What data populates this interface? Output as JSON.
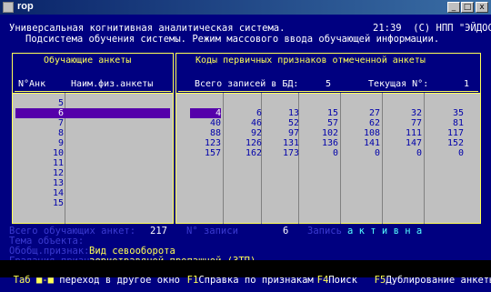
{
  "window": {
    "title": "rop",
    "icon_glyph": "",
    "minimize_glyph": "_",
    "maximize_glyph": "□",
    "close_glyph": "x"
  },
  "header": {
    "line1": "Универсальная когнитивная аналитическая система.",
    "time_and_copyright": "21:39  (C) НПП \"ЭЙДОС\"",
    "line2": "Подсистема обучения системы. Режим массового ввода обучающей информации."
  },
  "left_panel": {
    "title": "Обучающие анкеты",
    "col_num": "N°Анк",
    "col_name": "Наим.физ.анкеты",
    "rows": [
      "5",
      "6",
      "7",
      "8",
      "9",
      "10",
      "11",
      "12",
      "13",
      "14",
      "15"
    ],
    "selected_row": "6"
  },
  "right_panel": {
    "title": "Коды первичных признаков отмеченной анкеты",
    "total_label": "Всего записей в БД:",
    "total_value": "5",
    "current_label": "Текущая N°:",
    "current_value": "1",
    "grid": [
      [
        "4",
        "6",
        "13",
        "15",
        "27",
        "32",
        "35"
      ],
      [
        "40",
        "46",
        "52",
        "57",
        "62",
        "77",
        "81"
      ],
      [
        "88",
        "92",
        "97",
        "102",
        "108",
        "111",
        "117"
      ],
      [
        "123",
        "126",
        "131",
        "136",
        "141",
        "147",
        "152"
      ],
      [
        "157",
        "162",
        "173",
        "0",
        "0",
        "0",
        "0"
      ]
    ]
  },
  "info": {
    "all_label": "Всего обучающих анкет:",
    "all_value": "217",
    "rec_label": "N° записи",
    "rec_value": "6",
    "state_label": "Запись",
    "state_value": "а к т и в н а",
    "line2_label": "Тема объекта:",
    "line3_label": "Обобщ.признак:",
    "line3_value": "Вид севооборота",
    "line4_label": "Градация признака:",
    "line4_value": "зернотравяной пропашной (ЗТП)"
  },
  "hints": [
    {
      "key": "Таб ■-■",
      "text": " переход в другое окно "
    },
    {
      "key": "F1",
      "text": "Справка по признакам"
    },
    {
      "key": "F4",
      "text": "Поиск"
    },
    {
      "key": "F5",
      "text": "Дублирование анкеты"
    }
  ]
}
